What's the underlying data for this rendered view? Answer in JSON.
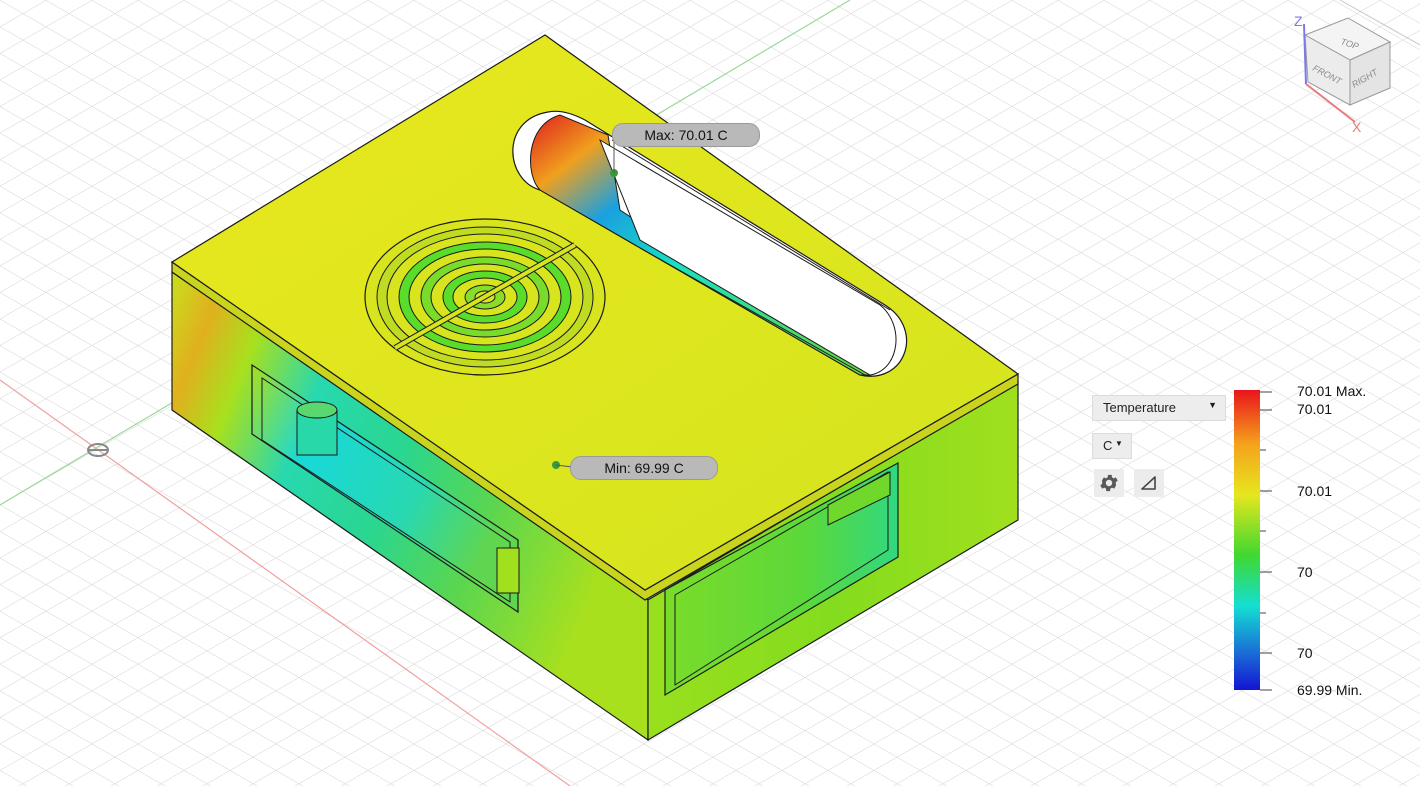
{
  "viewcube": {
    "axis_z": "Z",
    "axis_x": "X",
    "face_top": "TOP",
    "face_front": "FRONT",
    "face_right": "RIGHT"
  },
  "probes": {
    "max_label": "Max: 70.01 C",
    "min_label": "Min: 69.99 C"
  },
  "result_panel": {
    "quantity": "Temperature",
    "unit": "C",
    "settings_icon": "gear-icon",
    "mode_icon": "triangle-icon"
  },
  "legend": {
    "labels": [
      "70.01 Max.",
      "70.01",
      "70.01",
      "70",
      "70",
      "69.99 Min."
    ],
    "max_value": 70.01,
    "min_value": 69.99,
    "colors": [
      "#e8141b",
      "#f59a1c",
      "#e6e61e",
      "#78d71e",
      "#18e07a",
      "#14d2e6",
      "#1a5ad6",
      "#1414d2"
    ]
  },
  "colors": {
    "max": "#e8141b",
    "mid": "#d7e61e",
    "min": "#1414d2"
  }
}
